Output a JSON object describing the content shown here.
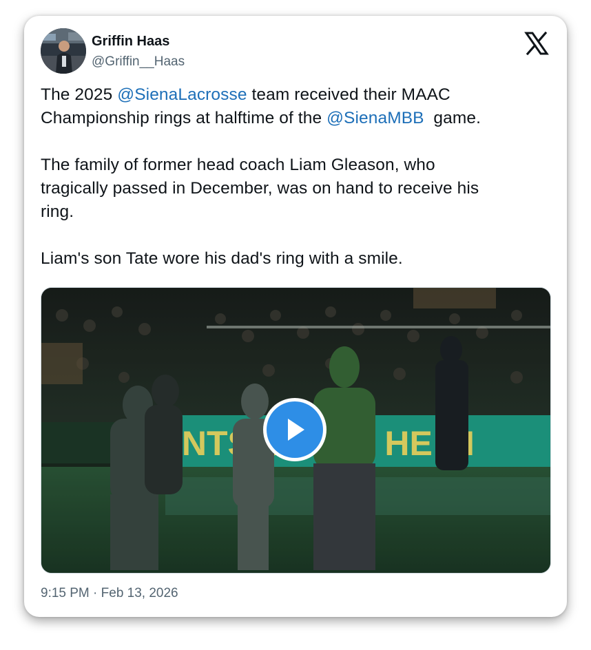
{
  "author": {
    "name": "Griffin Haas",
    "handle": "@Griffin__Haas"
  },
  "brand_icon": "x-logo-icon",
  "tweet": {
    "p1_before": "The 2025 ",
    "p1_mention1": "@SienaLacrosse",
    "p1_middle": " team received their MAAC",
    "p1_line2_before": "Championship rings at halftime of the ",
    "p1_mention2": "@SienaMBB",
    "p1_after": "  game.",
    "p2_line1": "The family of former head coach Liam Gleason, who",
    "p2_line2": "tragically passed in December, was on hand to receive his",
    "p2_line3": "ring.",
    "p3": "Liam's son Tate wore his dad's ring with a smile."
  },
  "media": {
    "type": "video",
    "play_icon": "play-icon",
    "scene_banner_text": "INTS   SIT ON  HE SI"
  },
  "timestamp": "9:15 PM · Feb 13, 2026",
  "colors": {
    "mention": "#1d6fb8",
    "play": "#2e8ee6",
    "secondary_text": "#536471"
  }
}
